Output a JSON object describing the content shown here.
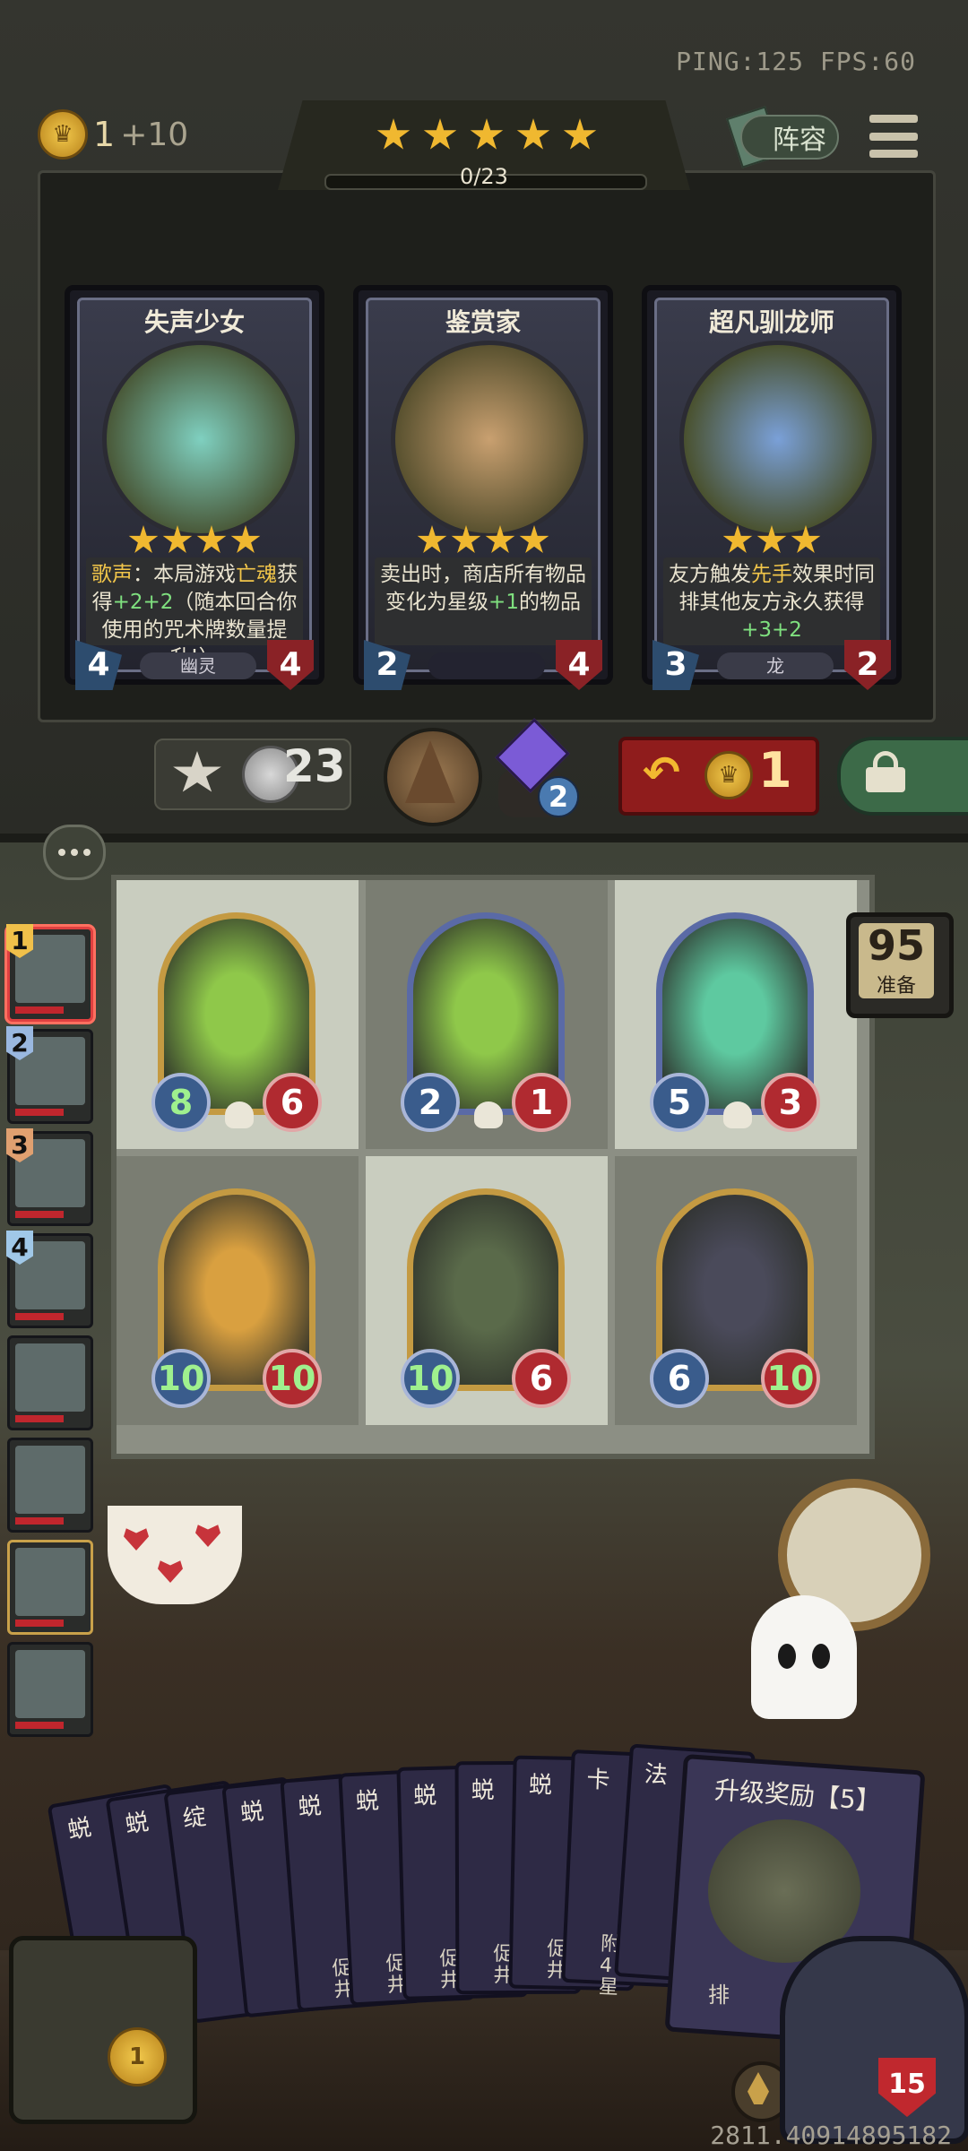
{
  "status": {
    "ping": "PING:125",
    "fps": "FPS:60"
  },
  "gold": {
    "amount": "1",
    "income": "+10"
  },
  "tier": {
    "stars": 5,
    "exp": "0/23"
  },
  "lineup_label": "阵容",
  "shop": [
    {
      "name": "失声少女",
      "stars": 4,
      "attack": "4",
      "health": "4",
      "tribe": "幽灵",
      "desc_parts": [
        {
          "t": "歌声",
          "c": "hl"
        },
        {
          "t": "：本局游戏"
        },
        {
          "t": "亡魂",
          "c": "hl"
        },
        {
          "t": "获得"
        },
        {
          "t": "+2+2",
          "c": "up"
        },
        {
          "t": "（随本回合你使用的咒术牌数量提升!）"
        }
      ]
    },
    {
      "name": "鉴赏家",
      "stars": 4,
      "attack": "2",
      "health": "4",
      "tribe": "",
      "desc_parts": [
        {
          "t": "卖出时，商店所有物品变化为星级"
        },
        {
          "t": "+1",
          "c": "up"
        },
        {
          "t": "的物品"
        }
      ]
    },
    {
      "name": "超凡驯龙师",
      "stars": 3,
      "attack": "3",
      "health": "2",
      "tribe": "龙",
      "desc_parts": [
        {
          "t": "友方触发"
        },
        {
          "t": "先手",
          "c": "hl"
        },
        {
          "t": "效果时同排其他友方永久获得"
        },
        {
          "t": "+3+2",
          "c": "up"
        }
      ]
    }
  ],
  "actions": {
    "upgrade_cost": "23",
    "bag_count": "2",
    "refresh_cost": "1"
  },
  "timer": {
    "value": "95",
    "label": "准备"
  },
  "players": [
    {
      "rank": "1",
      "state": "me"
    },
    {
      "rank": "2",
      "state": ""
    },
    {
      "rank": "3",
      "state": ""
    },
    {
      "rank": "4",
      "state": ""
    },
    {
      "rank": "",
      "state": ""
    },
    {
      "rank": "",
      "state": ""
    },
    {
      "rank": "",
      "state": "gold"
    },
    {
      "rank": "",
      "state": ""
    }
  ],
  "board": [
    {
      "attack": "8",
      "health": "6",
      "frame": "gold",
      "skull": true,
      "color": "#8fc84a",
      "atk_green": true,
      "hp_green": false
    },
    {
      "attack": "2",
      "health": "1",
      "frame": "silver",
      "skull": true,
      "color": "#8fc84a",
      "atk_green": false,
      "hp_green": false
    },
    {
      "attack": "5",
      "health": "3",
      "frame": "silver",
      "skull": true,
      "color": "#5ec9a0",
      "atk_green": false,
      "hp_green": false
    },
    {
      "attack": "10",
      "health": "10",
      "frame": "gold",
      "skull": false,
      "color": "#d9a040",
      "atk_green": true,
      "hp_green": true
    },
    {
      "attack": "10",
      "health": "6",
      "frame": "gold",
      "skull": false,
      "color": "#5a6a4a",
      "atk_green": true,
      "hp_green": false
    },
    {
      "attack": "6",
      "health": "10",
      "frame": "gold",
      "skull": false,
      "color": "#4a4a5a",
      "atk_green": false,
      "hp_green": true
    }
  ],
  "hand": [
    {
      "name": "蜕",
      "desc": ""
    },
    {
      "name": "蜕",
      "desc": ""
    },
    {
      "name": "绽",
      "desc": ""
    },
    {
      "name": "蜕",
      "desc": ""
    },
    {
      "name": "蜕",
      "desc": "促井"
    },
    {
      "name": "蜕",
      "desc": "促井"
    },
    {
      "name": "蜕",
      "desc": "促井"
    },
    {
      "name": "蜕",
      "desc": "促井"
    },
    {
      "name": "蜕",
      "desc": "促井"
    },
    {
      "name": "卡",
      "desc": "附4星"
    },
    {
      "name": "法",
      "desc": ""
    }
  ],
  "featured_card": {
    "name": "升级奖励【5】",
    "desc": "排"
  },
  "trophy": {
    "count": "1"
  },
  "hero": {
    "health": "15"
  },
  "coords": "2811.40914895182"
}
